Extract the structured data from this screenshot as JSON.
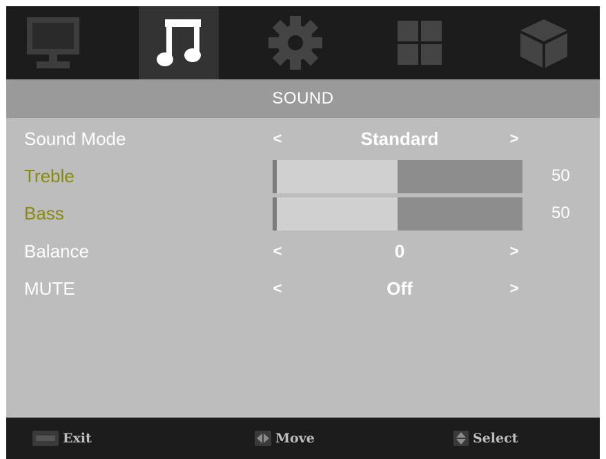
{
  "menu_tabs": [
    {
      "icon": "monitor-icon",
      "active": false
    },
    {
      "icon": "music-note-icon",
      "active": true
    },
    {
      "icon": "gear-icon",
      "active": false
    },
    {
      "icon": "grid-icon",
      "active": false
    },
    {
      "icon": "cube-icon",
      "active": false
    }
  ],
  "title": "SOUND",
  "rows": {
    "sound_mode": {
      "label": "Sound Mode",
      "value": "Standard",
      "left_arrow": "<",
      "right_arrow": ">"
    },
    "treble": {
      "label": "Treble",
      "value": "50",
      "level": 0.5
    },
    "bass": {
      "label": "Bass",
      "value": "50",
      "level": 0.5
    },
    "balance": {
      "label": "Balance",
      "value": "0",
      "left_arrow": "<",
      "right_arrow": ">"
    },
    "mute": {
      "label": "MUTE",
      "value": "Off",
      "left_arrow": "<",
      "right_arrow": ">"
    }
  },
  "footer": {
    "exit": {
      "key_icon": "menu-key-icon",
      "label": "Exit"
    },
    "move": {
      "key_icon": "left-right-key-icon",
      "label": "Move"
    },
    "select": {
      "key_icon": "up-down-key-icon",
      "label": "Select"
    }
  },
  "colors": {
    "highlight_label": "#8a8a10",
    "slider_fill": "#d0d0d0",
    "slider_track": "#8d8d8d"
  }
}
